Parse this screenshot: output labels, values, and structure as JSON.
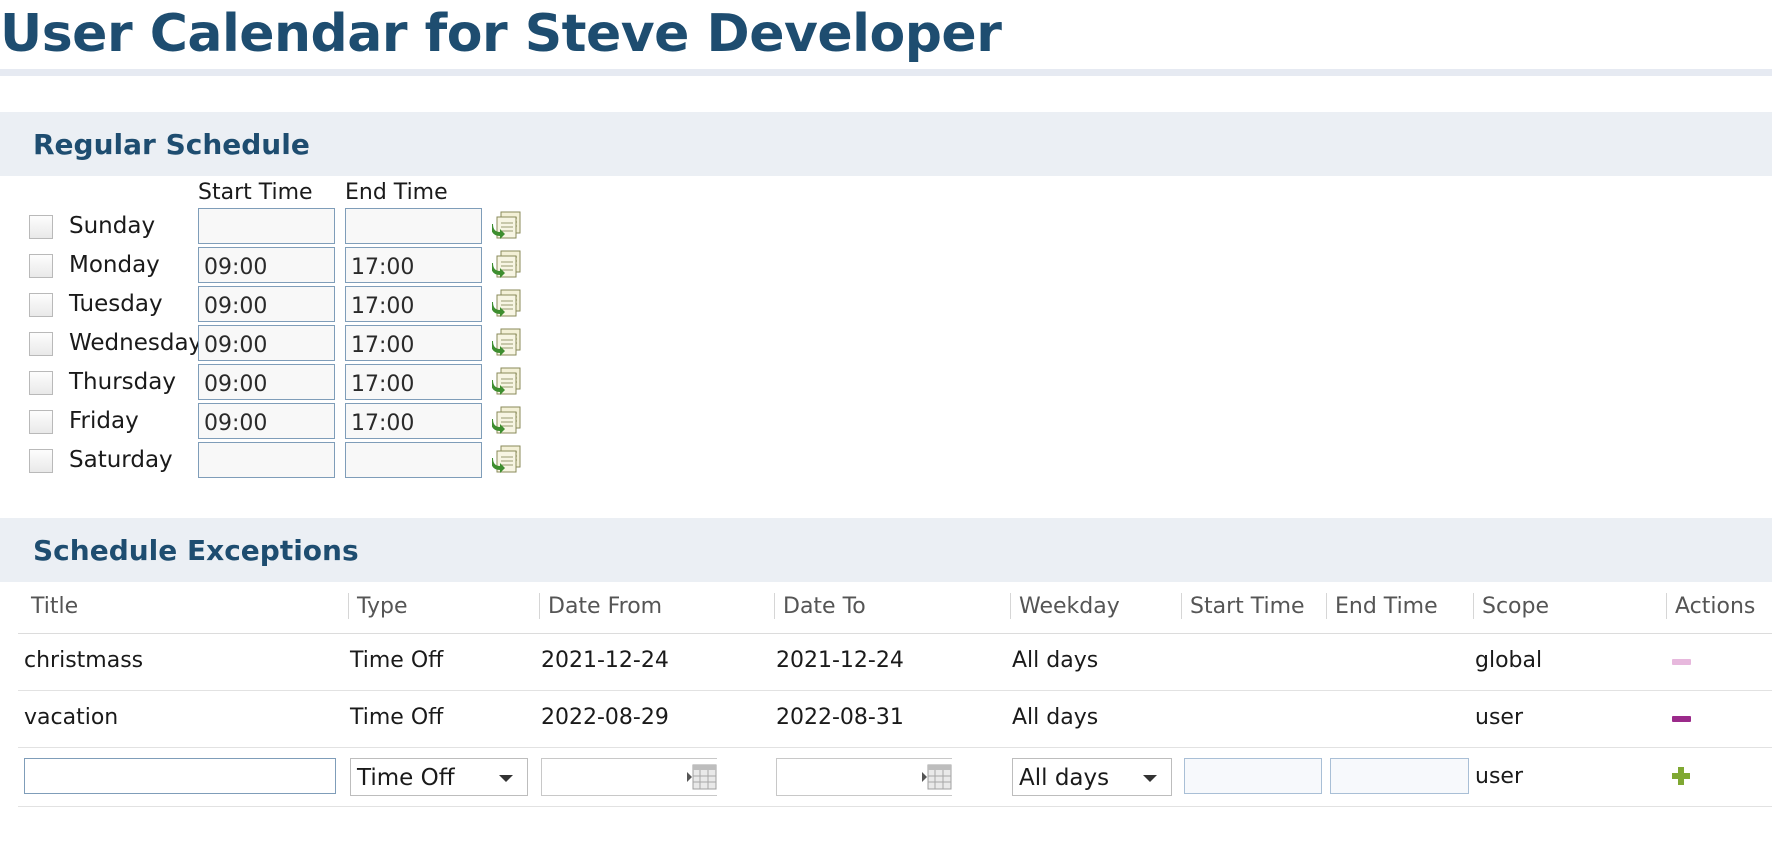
{
  "page": {
    "title": "User Calendar for Steve Developer"
  },
  "regular_schedule": {
    "heading": "Regular Schedule",
    "col_start": "Start Time",
    "col_end": "End Time",
    "days": [
      {
        "label": "Sunday",
        "start": "",
        "end": ""
      },
      {
        "label": "Monday",
        "start": "09:00",
        "end": "17:00"
      },
      {
        "label": "Tuesday",
        "start": "09:00",
        "end": "17:00"
      },
      {
        "label": "Wednesday",
        "start": "09:00",
        "end": "17:00"
      },
      {
        "label": "Thursday",
        "start": "09:00",
        "end": "17:00"
      },
      {
        "label": "Friday",
        "start": "09:00",
        "end": "17:00"
      },
      {
        "label": "Saturday",
        "start": "",
        "end": ""
      }
    ]
  },
  "exceptions": {
    "heading": "Schedule Exceptions",
    "columns": [
      "Title",
      "Type",
      "Date From",
      "Date To",
      "Weekday",
      "Start Time",
      "End Time",
      "Scope",
      "Actions"
    ],
    "rows": [
      {
        "title": "christmass",
        "type": "Time Off",
        "date_from": "2021-12-24",
        "date_to": "2021-12-24",
        "weekday": "All days",
        "start": "",
        "end": "",
        "scope": "global",
        "action": "remove-disabled"
      },
      {
        "title": "vacation",
        "type": "Time Off",
        "date_from": "2022-08-29",
        "date_to": "2022-08-31",
        "weekday": "All days",
        "start": "",
        "end": "",
        "scope": "user",
        "action": "remove"
      }
    ],
    "new_row": {
      "title": "",
      "type": "Time Off",
      "date_from": "",
      "date_to": "",
      "weekday": "All days",
      "start": "",
      "end": "",
      "scope": "user",
      "action": "add"
    }
  },
  "colors": {
    "title": "#1e4d70",
    "section_bg": "#ebeff4",
    "remove": "#9b2a8a",
    "remove_disabled": "#e7b8dd",
    "add": "#7fa832"
  },
  "icons": {
    "copy": "copy-schedule-icon",
    "calendar": "calendar-icon",
    "remove": "minus-icon",
    "add": "plus-icon"
  }
}
